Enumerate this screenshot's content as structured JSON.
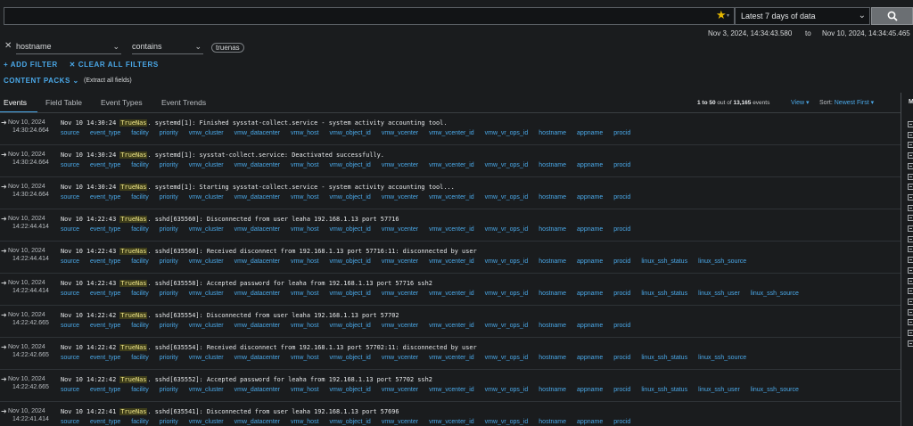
{
  "search": {
    "placeholder": "",
    "value": ""
  },
  "time_range": {
    "selected": "Latest 7 days of data"
  },
  "date_range": {
    "from": "Nov 3, 2024, 14:34:43.580",
    "to_label": "to",
    "to": "Nov 10, 2024, 14:34:45.465"
  },
  "filter": {
    "field": "hostname",
    "operator": "contains",
    "value": "truenas"
  },
  "actions": {
    "add_filter": "+ ADD FILTER",
    "clear_all": "✕ CLEAR ALL FILTERS"
  },
  "content_packs": {
    "label": "CONTENT PACKS",
    "note": "(Extract all fields)"
  },
  "tabs": [
    "Events",
    "Field Table",
    "Event Types",
    "Event Trends"
  ],
  "results": {
    "range": "1 to 50",
    "middle": "out of",
    "total": "13,165",
    "suffix": "events",
    "view_label": "View",
    "sort_label": "Sort:",
    "sort_value": "Newest First"
  },
  "right_panel": {
    "title": "M"
  },
  "colors": {
    "accent": "#4aa8e8",
    "highlight": "#f2e98a",
    "star": "#e6b800"
  },
  "events": [
    {
      "date": "Nov 10, 2024",
      "time": "14:30:24.664",
      "msg_pre": "Nov 10 14:30:24 ",
      "host": "TrueNas",
      "msg_post": ". systemd[1]: Finished sysstat-collect.service - system activity accounting tool.",
      "fields": [
        "source",
        "event_type",
        "facility",
        "priority",
        "vmw_cluster",
        "vmw_datacenter",
        "vmw_host",
        "vmw_object_id",
        "vmw_vcenter",
        "vmw_vcenter_id",
        "vmw_vr_ops_id",
        "hostname",
        "appname",
        "procid"
      ]
    },
    {
      "date": "Nov 10, 2024",
      "time": "14:30:24.664",
      "msg_pre": "Nov 10 14:30:24 ",
      "host": "TrueNas",
      "msg_post": ". systemd[1]: sysstat-collect.service: Deactivated successfully.",
      "fields": [
        "source",
        "event_type",
        "facility",
        "priority",
        "vmw_cluster",
        "vmw_datacenter",
        "vmw_host",
        "vmw_object_id",
        "vmw_vcenter",
        "vmw_vcenter_id",
        "vmw_vr_ops_id",
        "hostname",
        "appname",
        "procid"
      ]
    },
    {
      "date": "Nov 10, 2024",
      "time": "14:30:24.664",
      "msg_pre": "Nov 10 14:30:24 ",
      "host": "TrueNas",
      "msg_post": ". systemd[1]: Starting sysstat-collect.service - system activity accounting tool...",
      "fields": [
        "source",
        "event_type",
        "facility",
        "priority",
        "vmw_cluster",
        "vmw_datacenter",
        "vmw_host",
        "vmw_object_id",
        "vmw_vcenter",
        "vmw_vcenter_id",
        "vmw_vr_ops_id",
        "hostname",
        "appname",
        "procid"
      ]
    },
    {
      "date": "Nov 10, 2024",
      "time": "14:22:44.414",
      "msg_pre": "Nov 10 14:22:43 ",
      "host": "TrueNas",
      "msg_post": ". sshd[635560]: Disconnected from user leaha 192.168.1.13 port 57716",
      "fields": [
        "source",
        "event_type",
        "facility",
        "priority",
        "vmw_cluster",
        "vmw_datacenter",
        "vmw_host",
        "vmw_object_id",
        "vmw_vcenter",
        "vmw_vcenter_id",
        "vmw_vr_ops_id",
        "hostname",
        "appname",
        "procid"
      ]
    },
    {
      "date": "Nov 10, 2024",
      "time": "14:22:44.414",
      "msg_pre": "Nov 10 14:22:43 ",
      "host": "TrueNas",
      "msg_post": ". sshd[635560]: Received disconnect from 192.168.1.13 port 57716:11: disconnected by user",
      "fields": [
        "source",
        "event_type",
        "facility",
        "priority",
        "vmw_cluster",
        "vmw_datacenter",
        "vmw_host",
        "vmw_object_id",
        "vmw_vcenter",
        "vmw_vcenter_id",
        "vmw_vr_ops_id",
        "hostname",
        "appname",
        "procid",
        "linux_ssh_status",
        "linux_ssh_source"
      ]
    },
    {
      "date": "Nov 10, 2024",
      "time": "14:22:44.414",
      "msg_pre": "Nov 10 14:22:43 ",
      "host": "TrueNas",
      "msg_post": ". sshd[635558]: Accepted password for leaha from 192.168.1.13 port 57716 ssh2",
      "fields": [
        "source",
        "event_type",
        "facility",
        "priority",
        "vmw_cluster",
        "vmw_datacenter",
        "vmw_host",
        "vmw_object_id",
        "vmw_vcenter",
        "vmw_vcenter_id",
        "vmw_vr_ops_id",
        "hostname",
        "appname",
        "procid",
        "linux_ssh_status",
        "linux_ssh_user",
        "linux_ssh_source"
      ]
    },
    {
      "date": "Nov 10, 2024",
      "time": "14:22:42.665",
      "msg_pre": "Nov 10 14:22:42 ",
      "host": "TrueNas",
      "msg_post": ". sshd[635554]: Disconnected from user leaha 192.168.1.13 port 57702",
      "fields": [
        "source",
        "event_type",
        "facility",
        "priority",
        "vmw_cluster",
        "vmw_datacenter",
        "vmw_host",
        "vmw_object_id",
        "vmw_vcenter",
        "vmw_vcenter_id",
        "vmw_vr_ops_id",
        "hostname",
        "appname",
        "procid"
      ]
    },
    {
      "date": "Nov 10, 2024",
      "time": "14:22:42.665",
      "msg_pre": "Nov 10 14:22:42 ",
      "host": "TrueNas",
      "msg_post": ". sshd[635554]: Received disconnect from 192.168.1.13 port 57702:11: disconnected by user",
      "fields": [
        "source",
        "event_type",
        "facility",
        "priority",
        "vmw_cluster",
        "vmw_datacenter",
        "vmw_host",
        "vmw_object_id",
        "vmw_vcenter",
        "vmw_vcenter_id",
        "vmw_vr_ops_id",
        "hostname",
        "appname",
        "procid",
        "linux_ssh_status",
        "linux_ssh_source"
      ]
    },
    {
      "date": "Nov 10, 2024",
      "time": "14:22:42.665",
      "msg_pre": "Nov 10 14:22:42 ",
      "host": "TrueNas",
      "msg_post": ". sshd[635552]: Accepted password for leaha from 192.168.1.13 port 57702 ssh2",
      "fields": [
        "source",
        "event_type",
        "facility",
        "priority",
        "vmw_cluster",
        "vmw_datacenter",
        "vmw_host",
        "vmw_object_id",
        "vmw_vcenter",
        "vmw_vcenter_id",
        "vmw_vr_ops_id",
        "hostname",
        "appname",
        "procid",
        "linux_ssh_status",
        "linux_ssh_user",
        "linux_ssh_source"
      ]
    },
    {
      "date": "Nov 10, 2024",
      "time": "14:22:41.414",
      "msg_pre": "Nov 10 14:22:41 ",
      "host": "TrueNas",
      "msg_post": ". sshd[635541]: Disconnected from user leaha 192.168.1.13 port 57696",
      "fields": [
        "source",
        "event_type",
        "facility",
        "priority",
        "vmw_cluster",
        "vmw_datacenter",
        "vmw_host",
        "vmw_object_id",
        "vmw_vcenter",
        "vmw_vcenter_id",
        "vmw_vr_ops_id",
        "hostname",
        "appname",
        "procid"
      ]
    }
  ]
}
